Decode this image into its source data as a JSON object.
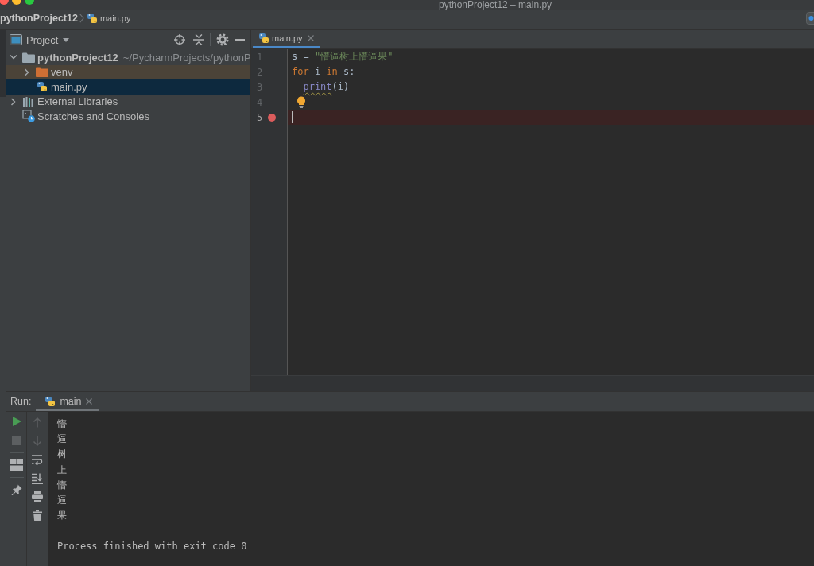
{
  "window": {
    "title": "pythonProject12 – main.py"
  },
  "nav_bar": {
    "breadcrumbs": [
      {
        "label": "pythonProject12",
        "kind": "project"
      },
      {
        "label": "main.py",
        "kind": "python-file"
      }
    ]
  },
  "project_panel": {
    "title": "Project",
    "tree": [
      {
        "label": "pythonProject12",
        "path": "~/PycharmProjects/pythonP",
        "kind": "project-root",
        "expanded": true,
        "selected": false,
        "children": [
          {
            "label": "venv",
            "kind": "excluded-folder",
            "expanded": false,
            "selected": false
          },
          {
            "label": "main.py",
            "kind": "python-file",
            "selected": true
          }
        ]
      },
      {
        "label": "External Libraries",
        "kind": "libraries",
        "expanded": false,
        "selected": false
      },
      {
        "label": "Scratches and Consoles",
        "kind": "scratches",
        "selected": false
      }
    ]
  },
  "editor": {
    "tabs": [
      {
        "label": "main.py",
        "selected": true
      }
    ],
    "lines": [
      {
        "number": "1",
        "breakpoint": false,
        "caret": false,
        "bulb": false,
        "tokens": [
          {
            "text": "s = ",
            "kind": "plain",
            "warning": false
          },
          {
            "text": "\"懵逼树上懵逼果\"",
            "kind": "string",
            "warning": false
          }
        ]
      },
      {
        "number": "2",
        "breakpoint": false,
        "caret": false,
        "bulb": false,
        "tokens": [
          {
            "text": "for",
            "kind": "keyword",
            "warning": false
          },
          {
            "text": " i ",
            "kind": "plain",
            "warning": false
          },
          {
            "text": "in",
            "kind": "keyword",
            "warning": false
          },
          {
            "text": " s:",
            "kind": "plain",
            "warning": false
          }
        ],
        "children": [
          {
            "number": "3",
            "breakpoint": false,
            "caret": false,
            "bulb": false,
            "tokens": [
              {
                "text": "print",
                "kind": "builtin",
                "warning": true
              },
              {
                "text": "(i)",
                "kind": "plain",
                "warning": false
              }
            ]
          }
        ]
      },
      {
        "number": "4",
        "breakpoint": false,
        "caret": false,
        "bulb": true
      },
      {
        "number": "5",
        "breakpoint": true,
        "caret": true,
        "bulb": false
      }
    ]
  },
  "run_panel": {
    "title": "Run:",
    "tabs": [
      {
        "label": "main",
        "selected": true
      }
    ],
    "tools": [
      {
        "kind": "run",
        "disabled": false
      },
      {
        "kind": "stop",
        "disabled": true
      },
      {
        "kind": "layout",
        "disabled": false
      },
      {
        "kind": "pin",
        "disabled": false
      }
    ],
    "console_tools": [
      {
        "kind": "up",
        "disabled": true
      },
      {
        "kind": "down",
        "disabled": true
      },
      {
        "kind": "soft-wrap",
        "disabled": false
      },
      {
        "kind": "scroll-to-end",
        "disabled": false
      },
      {
        "kind": "print",
        "disabled": false
      },
      {
        "kind": "trash",
        "disabled": false
      }
    ],
    "output": [
      "懵",
      "逼",
      "树",
      "上",
      "懵",
      "逼",
      "果"
    ],
    "exit_message": "Process finished with exit code 0"
  }
}
